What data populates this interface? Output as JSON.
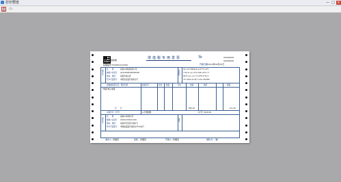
{
  "window": {
    "title": "打印预览",
    "controls": [
      "—",
      "□",
      "×"
    ]
  },
  "toolbar": {
    "buttons": [
      {
        "glyph": "⎙",
        "active": true
      },
      {
        "glyph": "▭",
        "active": false
      }
    ]
  },
  "invoice": {
    "title": "增值税专用发票",
    "no_symbol": "№",
    "invoice_no": "00000000",
    "right_code": "00000000",
    "copy_label": "抵扣联",
    "machine_no": "机器编号",
    "machine_no_value": "559951212456",
    "date_label": "开票日期",
    "date_value": "2016年09月25日",
    "buyer": {
      "side_label": "购买方",
      "name_label": "名　　称",
      "name_value": "深圳XX科技有限公司",
      "tax_label": "纳税人识别号",
      "tax_value": "91310000000000000",
      "addr_label": "地址、电话",
      "addr_value": "深圳市南山区",
      "bank_label": "开户行及账号",
      "bank_value": "中国农业银行深圳分行"
    },
    "cipher": {
      "label": "密码区",
      "lines": [
        "03<2/7*0654/9+6-0**3<9*1",
        "*79+6-+2<4*4<8/9+4*6<*7",
        "8471+2<-4+*/7+9*8-3*6<2",
        "*0*+8/6+0<8/*7+02<46/958"
      ]
    },
    "columns": [
      "货物或应税劳务、服务名称",
      "规格型号",
      "单位",
      "数量",
      "单价",
      "金额",
      "税率",
      "税额"
    ],
    "item": {
      "name": "*电器*电子电器",
      "amount": "",
      "tax": ""
    },
    "total_label": "合　　计",
    "total_amount": "¥80.00",
    "total_tax": "¥11.50",
    "tax_total_label": "价税合计（大写）",
    "tax_total_upper": "⊗ 壹佰圆整",
    "tax_total_small": "（小写）¥100.00",
    "seller": {
      "side_label": "销售方",
      "name_label": "名　　称",
      "name_value": "深圳XX有限公司",
      "tax_label": "纳税人识别号",
      "tax_value": "91W12345012345",
      "addr_label": "地址、电话",
      "addr_value": "深圳市宝安区XX路1号",
      "bank_label": "开户行及账号",
      "bank_value": "中国建设银行深圳分行XX支行"
    },
    "remarks_label": "备注",
    "payee_label": "收款人：",
    "payee": "管理员",
    "reviewer_label": "复核：",
    "reviewer": "管理员",
    "drawer_label": "开票人：",
    "drawer": "管理员",
    "seller_sign_label": "销售方：（章）"
  }
}
